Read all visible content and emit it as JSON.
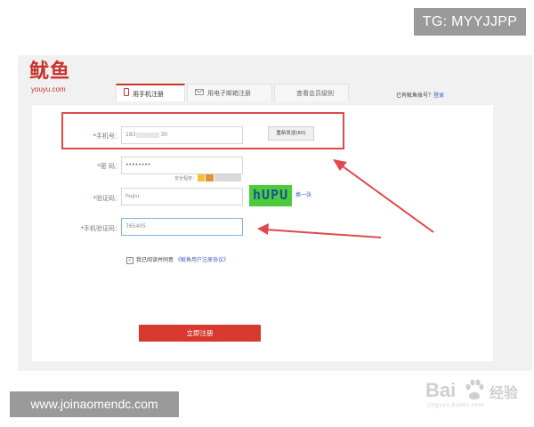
{
  "watermark_top": "TG: MYYJJPP",
  "watermark_bottom": "www.joinaomendc.com",
  "logo": {
    "cn": "鱿鱼",
    "en": "youyu.com"
  },
  "tabs": [
    {
      "label": "用手机注册",
      "active": true
    },
    {
      "label": "用电子邮箱注册",
      "active": false
    },
    {
      "label": "查看会员级别",
      "active": false
    }
  ],
  "login_hint": {
    "text": "已有鱿鱼账号？",
    "link": "登录"
  },
  "form": {
    "phone": {
      "label": "手机号：",
      "value": "183",
      "value_end": "30",
      "button": "重新发送(60)"
    },
    "password": {
      "label": "密  码：",
      "value": "••••••••",
      "strength_label": "安全程度："
    },
    "captcha": {
      "label": "验证码：",
      "value": "hupu",
      "image_text": "hUPU",
      "swap_link": "换一张"
    },
    "sms_code": {
      "label": "手机验证码：",
      "value": "765405"
    },
    "agree": {
      "checked": true,
      "text": "我已阅读并同意",
      "link": "《鱿鱼用户注册协议》"
    },
    "submit": "立即注册"
  },
  "baidu_watermark": {
    "main": "Bai",
    "cn": "经验",
    "sub": "jingyan.baidu.com"
  },
  "colors": {
    "accent": "#d8392f",
    "highlight": "#e0494b",
    "link": "#3a63c5",
    "captcha_bg": "#4ccc3a"
  }
}
